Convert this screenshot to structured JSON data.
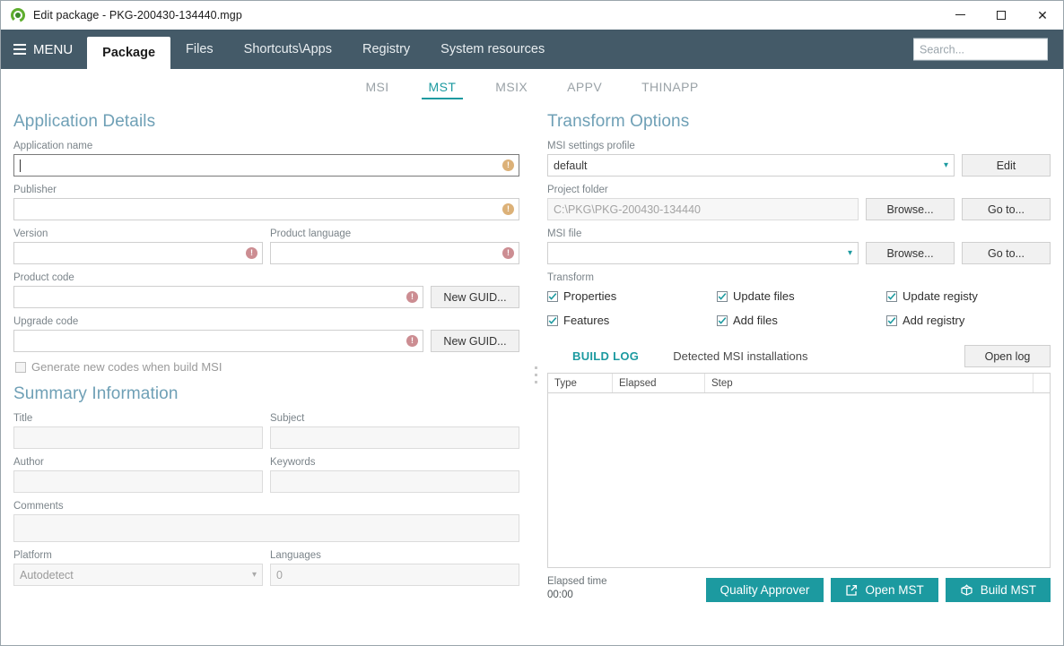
{
  "window": {
    "title": "Edit package - PKG-200430-134440.mgp",
    "app_icon": "app-logo-icon",
    "minimize_label": "–",
    "maximize_label": "□",
    "close_label": "✕"
  },
  "nav": {
    "menu_label": "MENU",
    "tabs": [
      {
        "label": "Package",
        "active": true
      },
      {
        "label": "Files",
        "active": false
      },
      {
        "label": "Shortcuts\\Apps",
        "active": false
      },
      {
        "label": "Registry",
        "active": false
      },
      {
        "label": "System resources",
        "active": false
      }
    ],
    "search": {
      "value": "",
      "placeholder": "Search...",
      "icon": "search-icon"
    }
  },
  "subtabs": [
    {
      "label": "MSI",
      "active": false
    },
    {
      "label": "MST",
      "active": true
    },
    {
      "label": "MSIX",
      "active": false
    },
    {
      "label": "APPV",
      "active": false
    },
    {
      "label": "THINAPP",
      "active": false
    }
  ],
  "application_details": {
    "heading": "Application Details",
    "application_name": {
      "label": "Application name",
      "value": "",
      "status": "warning"
    },
    "publisher": {
      "label": "Publisher",
      "value": "",
      "status": "warning"
    },
    "version": {
      "label": "Version",
      "value": "",
      "status": "error"
    },
    "product_language": {
      "label": "Product language",
      "value": "",
      "status": "error"
    },
    "product_code": {
      "label": "Product code",
      "value": "",
      "status": "error",
      "button": "New GUID..."
    },
    "upgrade_code": {
      "label": "Upgrade code",
      "value": "",
      "status": "error",
      "button": "New GUID..."
    },
    "generate_new_codes": {
      "label": "Generate new codes when build MSI",
      "checked": false
    }
  },
  "summary_information": {
    "heading": "Summary Information",
    "title": {
      "label": "Title",
      "value": ""
    },
    "subject": {
      "label": "Subject",
      "value": ""
    },
    "author": {
      "label": "Author",
      "value": ""
    },
    "keywords": {
      "label": "Keywords",
      "value": ""
    },
    "comments": {
      "label": "Comments",
      "value": ""
    },
    "platform": {
      "label": "Platform",
      "value": "Autodetect"
    },
    "languages": {
      "label": "Languages",
      "value": "0"
    }
  },
  "transform_options": {
    "heading": "Transform Options",
    "msi_settings_profile": {
      "label": "MSI settings profile",
      "value": "default",
      "button": "Edit"
    },
    "project_folder": {
      "label": "Project folder",
      "value": "C:\\PKG\\PKG-200430-134440",
      "browse": "Browse...",
      "goto": "Go to..."
    },
    "msi_file": {
      "label": "MSI file",
      "value": "",
      "browse": "Browse...",
      "goto": "Go to..."
    },
    "transform": {
      "label": "Transform",
      "options": [
        {
          "label": "Properties",
          "checked": true
        },
        {
          "label": "Update files",
          "checked": true
        },
        {
          "label": "Update registy",
          "checked": true
        },
        {
          "label": "Features",
          "checked": true
        },
        {
          "label": "Add files",
          "checked": true
        },
        {
          "label": "Add registry",
          "checked": true
        }
      ]
    }
  },
  "build_log": {
    "tabs": [
      {
        "label": "BUILD LOG",
        "active": true
      },
      {
        "label": "Detected MSI installations",
        "active": false
      }
    ],
    "open_log_button": "Open log",
    "columns": [
      "Type",
      "Elapsed",
      "Step"
    ],
    "rows": []
  },
  "footer": {
    "elapsed_label": "Elapsed time",
    "elapsed_value": "00:00",
    "buttons": [
      {
        "label": "Quality Approver",
        "icon": ""
      },
      {
        "label": "Open MST",
        "icon": "external-link-icon"
      },
      {
        "label": "Build MST",
        "icon": "build-package-icon"
      }
    ]
  },
  "colors": {
    "navbar": "#445a68",
    "accent_teal": "#1c9aa0",
    "heading_blue": "#6fa0b6",
    "warning": "#dcb178",
    "error": "#cc8d92"
  }
}
